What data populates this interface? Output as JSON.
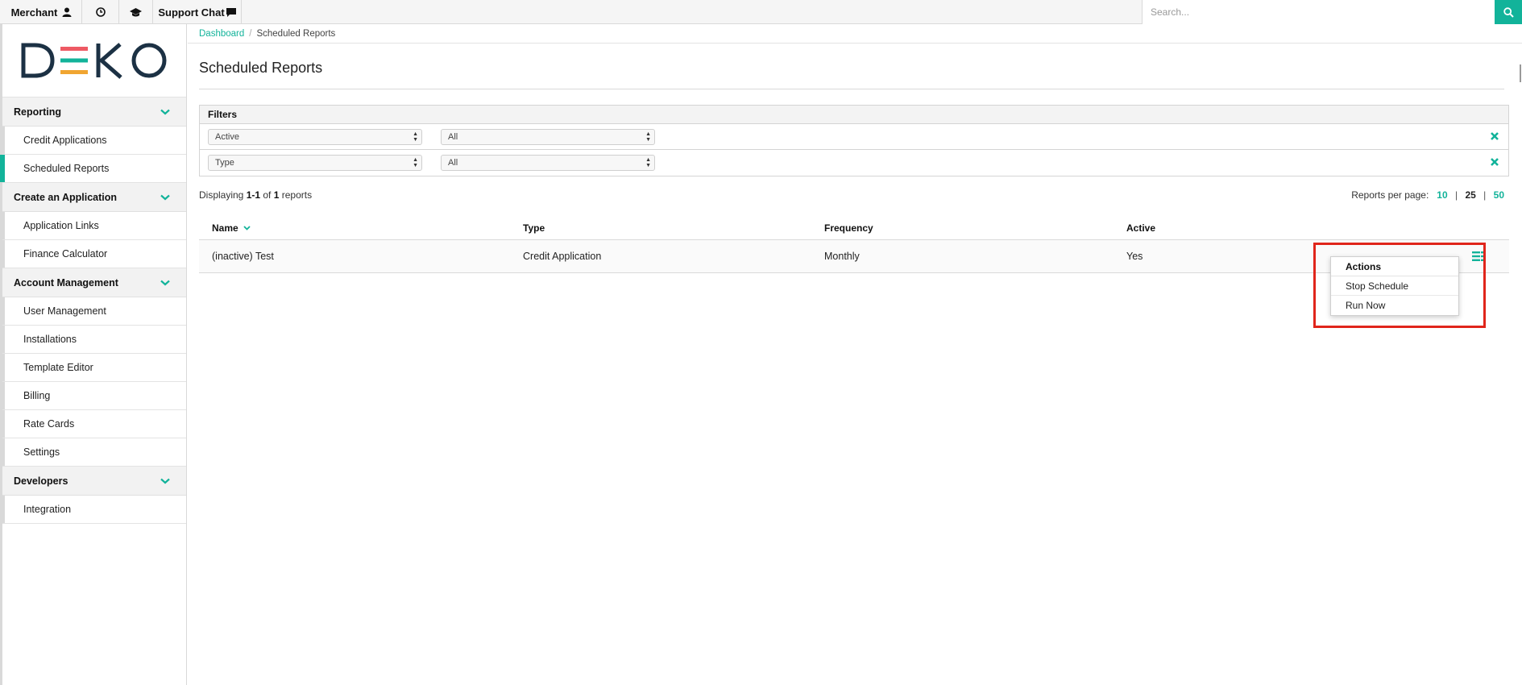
{
  "topbar": {
    "merchant_label": "Merchant",
    "support_chat_label": "Support Chat",
    "search_placeholder": "Search..."
  },
  "sidebar": {
    "logo_text": "DEKO",
    "sections": [
      {
        "title": "Reporting",
        "items": [
          "Credit Applications",
          "Scheduled Reports"
        ]
      },
      {
        "title": "Create an Application",
        "items": [
          "Application Links",
          "Finance Calculator"
        ]
      },
      {
        "title": "Account Management",
        "items": [
          "User Management",
          "Installations",
          "Template Editor",
          "Billing",
          "Rate Cards",
          "Settings"
        ]
      },
      {
        "title": "Developers",
        "items": [
          "Integration"
        ]
      }
    ],
    "active_item": "Scheduled Reports"
  },
  "breadcrumb": {
    "home": "Dashboard",
    "separator": "/",
    "current": "Scheduled Reports"
  },
  "page_title": "Scheduled Reports",
  "filters": {
    "title": "Filters",
    "rows": [
      {
        "field": "Active",
        "value": "All"
      },
      {
        "field": "Type",
        "value": "All"
      }
    ]
  },
  "listing": {
    "prefix": "Displaying ",
    "range": "1-1",
    "of": " of ",
    "total": "1",
    "suffix": " reports",
    "per_page_label": "Reports per page:",
    "per_page_options": [
      "10",
      "25",
      "50"
    ],
    "per_page_current": "25",
    "per_page_separator": "|"
  },
  "table": {
    "columns": [
      "Name",
      "Type",
      "Frequency",
      "Active"
    ],
    "rows": [
      {
        "name": "(inactive) Test",
        "type": "Credit Application",
        "frequency": "Monthly",
        "active": "Yes"
      }
    ]
  },
  "actions_menu": {
    "title": "Actions",
    "items": [
      "Stop Schedule",
      "Run Now"
    ]
  },
  "colors": {
    "accent": "#12b39a",
    "highlight": "#e0251b",
    "logo_red": "#ee5a64",
    "logo_green": "#12b39a",
    "logo_orange": "#f0a531",
    "logo_dark": "#1c3144"
  },
  "icons": [
    "user-icon",
    "clock-icon",
    "graduation-cap-icon",
    "chat-icon",
    "search-icon",
    "chevron-down-icon",
    "close-icon",
    "sort-down-icon",
    "actions-list-icon"
  ]
}
